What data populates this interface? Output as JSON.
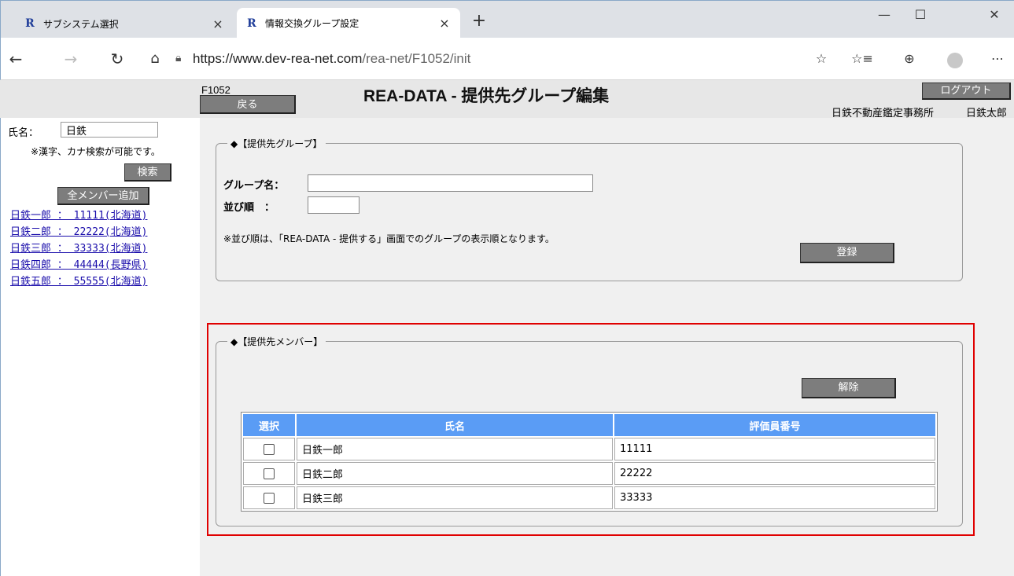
{
  "browser": {
    "tabs": [
      {
        "favicon": "R",
        "title": "サブシステム選択",
        "close": "×"
      },
      {
        "favicon": "R",
        "title": "情報交換グループ設定",
        "close": "×"
      }
    ],
    "new_tab": "+",
    "window_controls": {
      "minimize": "—",
      "maximize": "☐",
      "close": "✕"
    },
    "url_host": "https://www.dev-rea-net.com",
    "url_path": "/rea-net/F1052/init"
  },
  "header": {
    "screen_id": "F1052",
    "back_label": "戻る",
    "title": "REA-DATA - 提供先グループ編集",
    "logout_label": "ログアウト",
    "office": "日鉄不動産鑑定事務所",
    "user": "日鉄太郎"
  },
  "sidebar": {
    "name_label": "氏名：",
    "name_value": "日鉄",
    "note": "※漢字、カナ検索が可能です。",
    "search_label": "検索",
    "add_all_label": "全メンバー追加",
    "results": [
      "日鉄一郎 ： 11111(北海道)",
      "日鉄二郎 ： 22222(北海道)",
      "日鉄三郎 ： 33333(北海道)",
      "日鉄四郎 ： 44444(長野県)",
      "日鉄五郎 ： 55555(北海道)"
    ]
  },
  "group_section": {
    "legend": "◆【提供先グループ】",
    "group_name_label": "グループ名：",
    "group_name_value": "",
    "order_label": "並び順　：",
    "order_value": "",
    "note": "※並び順は、「REA-DATA - 提供する」画面でのグループの表示順となります。",
    "register_label": "登録"
  },
  "member_section": {
    "legend": "◆【提供先メンバー】",
    "release_label": "解除",
    "columns": [
      "選択",
      "氏名",
      "評価員番号"
    ],
    "rows": [
      {
        "name": "日鉄一郎",
        "number": "11111",
        "checked": false
      },
      {
        "name": "日鉄二郎",
        "number": "22222",
        "checked": false
      },
      {
        "name": "日鉄三郎",
        "number": "33333",
        "checked": false
      }
    ]
  },
  "colors": {
    "button_gray": "#7d7d7d",
    "table_header": "#5a9cf5",
    "highlight_frame": "#e00000",
    "link": "#1a0dab"
  }
}
